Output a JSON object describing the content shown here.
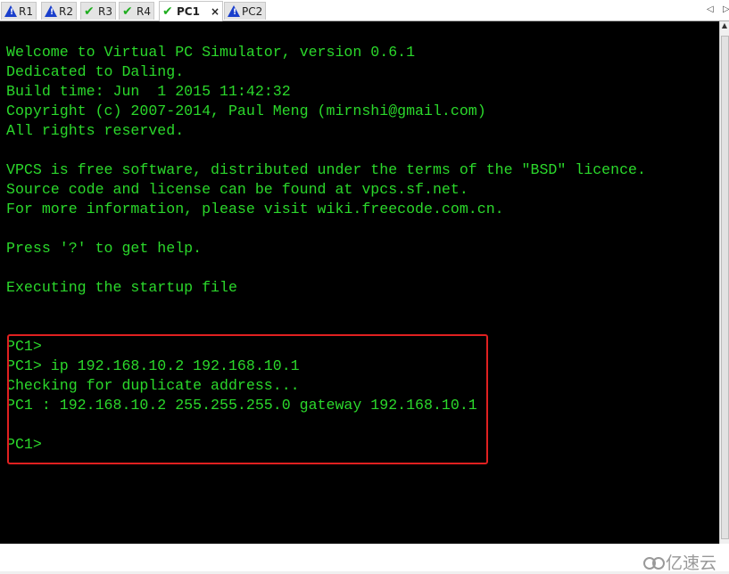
{
  "tabs": [
    {
      "label": "R1",
      "status": "warning-icon"
    },
    {
      "label": "R2",
      "status": "warning-icon"
    },
    {
      "label": "R3",
      "status": "check-icon"
    },
    {
      "label": "R4",
      "status": "check-icon"
    },
    {
      "label": "PC1",
      "status": "check-icon",
      "active": true
    },
    {
      "label": "PC2",
      "status": "warning-icon"
    }
  ],
  "close_label": "×",
  "terminal": {
    "lines": [
      "Welcome to Virtual PC Simulator, version 0.6.1",
      "Dedicated to Daling.",
      "Build time: Jun  1 2015 11:42:32",
      "Copyright (c) 2007-2014, Paul Meng (mirnshi@gmail.com)",
      "All rights reserved.",
      "",
      "VPCS is free software, distributed under the terms of the \"BSD\" licence.",
      "Source code and license can be found at vpcs.sf.net.",
      "For more information, please visit wiki.freecode.com.cn.",
      "",
      "Press '?' to get help.",
      "",
      "Executing the startup file",
      "",
      "",
      "PC1>",
      "PC1> ip 192.168.10.2 192.168.10.1",
      "Checking for duplicate address...",
      "PC1 : 192.168.10.2 255.255.255.0 gateway 192.168.10.1",
      "",
      "PC1>"
    ],
    "text_color": "#2bd82b",
    "highlight_color": "#e02020"
  },
  "watermark": "亿速云"
}
